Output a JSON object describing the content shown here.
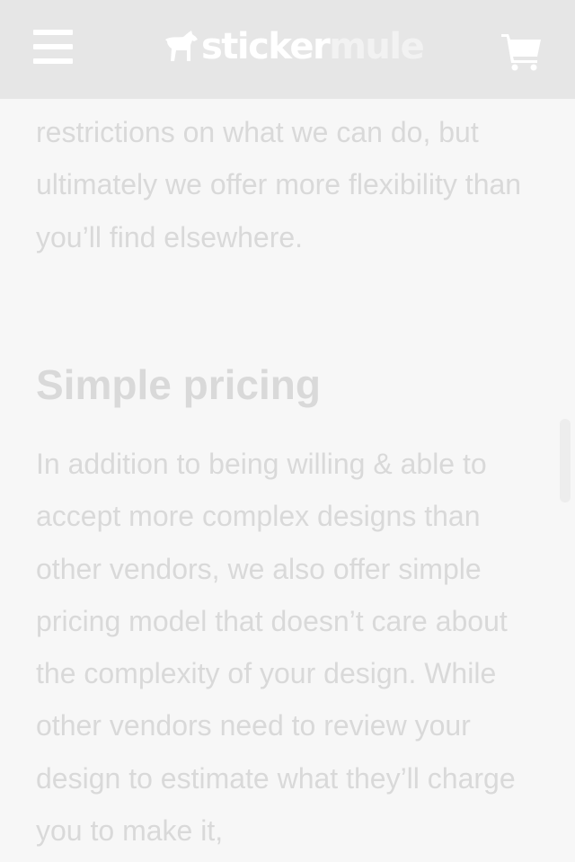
{
  "header": {
    "menu_icon": "hamburger-menu-icon",
    "logo": {
      "part1": "sticker",
      "part2": "mule",
      "icon": "mule-logo-icon"
    },
    "cart_icon": "shopping-cart-icon"
  },
  "content": {
    "paragraph_1": "restrictions on what we can do, but ultimately we offer more flexibility than you’ll find elsewhere.",
    "heading": "Simple pricing",
    "paragraph_2": "In addition to being willing & able to accept more complex designs than other vendors, we also offer simple pricing model that doesn’t care about the complexity of your design. While other vendors need to review your design to estimate what they’ll charge you to make it,"
  },
  "colors": {
    "header_bg": "#e6e6e6",
    "page_bg": "#f7f7f7",
    "text": "#d9d9d9",
    "logo_primary": "#ffffff"
  }
}
